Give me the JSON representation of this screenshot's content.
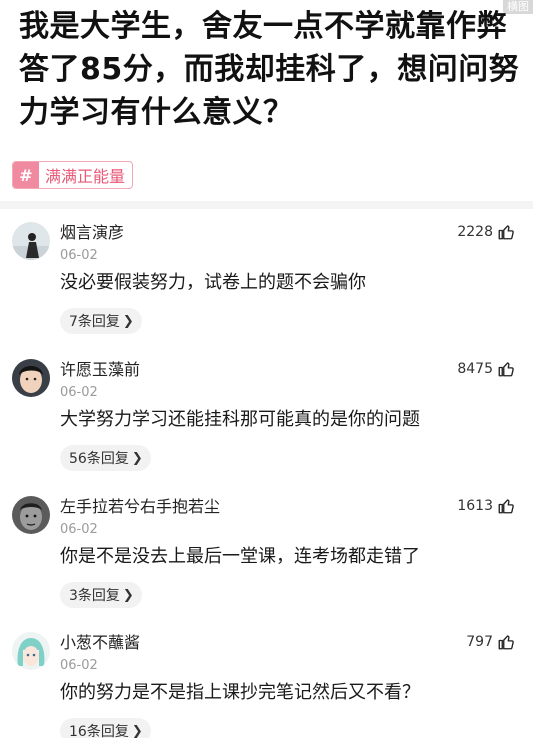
{
  "corner_tag": "横图",
  "post": {
    "title": "我是大学生，舍友一点不学就靠作弊答了85分，而我却挂科了，想问问努力学习有什么意义？"
  },
  "topic": {
    "hash_icon": "hash-icon",
    "label": "满满正能量"
  },
  "comments": [
    {
      "username": "烟言演彦",
      "date": "06-02",
      "likes": "2228",
      "content": "没必要假装努力，试卷上的题不会骗你",
      "replies": "7条回复"
    },
    {
      "username": "许愿玉藻前",
      "date": "06-02",
      "likes": "8475",
      "content": "大学努力学习还能挂科那可能真的是你的问题",
      "replies": "56条回复"
    },
    {
      "username": "左手拉若兮右手抱若尘",
      "date": "06-02",
      "likes": "1613",
      "content": "你是不是没去上最后一堂课，连考场都走错了",
      "replies": "3条回复"
    },
    {
      "username": "小葱不蘸酱",
      "date": "06-02",
      "likes": "797",
      "content": "你的努力是不是指上课抄完笔记然后又不看？",
      "replies": "16条回复"
    }
  ],
  "icons": {
    "like": "thumbs-up-icon",
    "chevron": "chevron-right-icon"
  }
}
